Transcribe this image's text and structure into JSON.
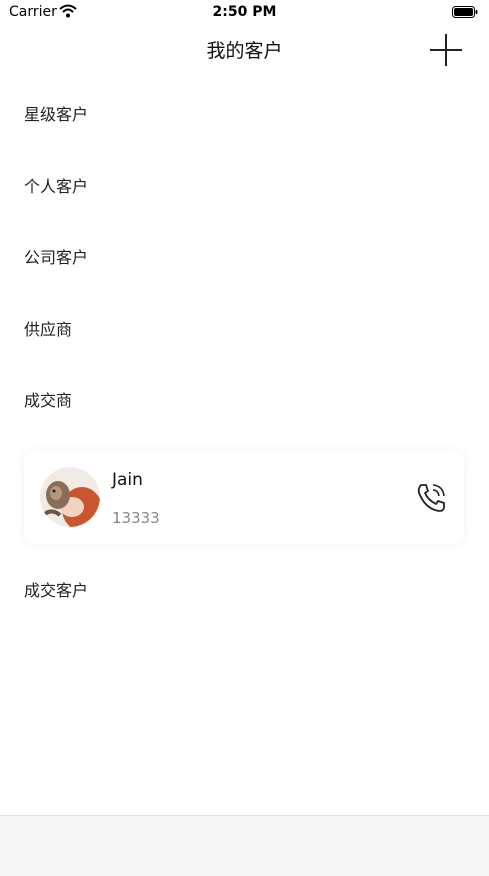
{
  "status_bar": {
    "carrier": "Carrier",
    "time": "2:50 PM",
    "wifi_icon": "wifi-icon",
    "battery_icon": "battery-icon"
  },
  "nav": {
    "title": "我的客户",
    "add_icon": "plus-icon"
  },
  "groups": [
    {
      "label": "星级客户"
    },
    {
      "label": "个人客户"
    },
    {
      "label": "公司客户"
    },
    {
      "label": "供应商"
    },
    {
      "label": "成交商"
    },
    {
      "label": "成交客户"
    }
  ],
  "contact": {
    "name": "Jain",
    "phone": "13333",
    "avatar_icon": "avatar-photo",
    "call_icon": "phone-icon"
  },
  "colors": {
    "background": "#ffffff",
    "text": "#222222",
    "secondary_text": "#888888",
    "tab_bar": "#f7f7f7"
  }
}
